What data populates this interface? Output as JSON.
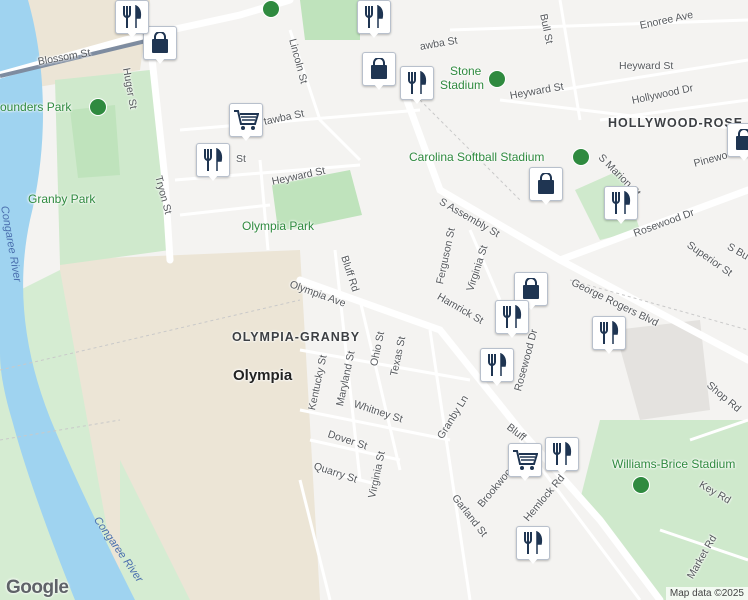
{
  "map": {
    "streets": {
      "blossom": "Blossom St",
      "huger": "Huger St",
      "lincoln": "Lincoln St",
      "catawba1": "awba St",
      "catawba2": "tawba St",
      "heyward_w": "Heyward St",
      "heyward_e": "Heyward St",
      "tryon": "Tryon St",
      "greene_frag": "St",
      "s_assembly": "S Assembly St",
      "bluff_rd": "Bluff Rd",
      "bluff_frag": "Bluff",
      "olympia_ave": "Olympia Ave",
      "ferguson": "Ferguson St",
      "virginia_n": "Virginia St",
      "virginia_s": "Virginia St",
      "hamrick": "Hamrick St",
      "rosewood_dr": "Rosewood Dr",
      "rosewood_dr_e": "Rosewood Dr",
      "george_rogers": "George Rogers Blvd",
      "kentucky": "Kentucky St",
      "maryland": "Maryland St",
      "ohio": "Ohio St",
      "texas": "Texas St",
      "whitney": "Whitney St",
      "granby_ln": "Granby Ln",
      "dover": "Dover St",
      "quarry": "Quarry St",
      "brookwood": "Brookwood",
      "garland": "Garland St",
      "hemlock": "Hemlock Rd",
      "key_rd": "Key Rd",
      "market_rd": "Market Rd",
      "shop_rd": "Shop Rd",
      "bull": "Bull St",
      "enoree": "Enoree Ave",
      "hollywood": "Hollywood Dr",
      "s_marion": "S Marion St",
      "superior": "Superior St",
      "pinewood": "Pinewo",
      "s_bu": "S Bu"
    },
    "places": {
      "founders_park": "ounders Park",
      "granby_park": "Granby Park",
      "olympia_park": "Olympia Park",
      "olympia_granby": "OLYMPIA-GRANBY",
      "olympia": "Olympia",
      "stone_stadium": "Stone",
      "stone_stadium2": "Stadium",
      "softball_stadium": "Carolina Softball Stadium",
      "williams_brice": "Williams-Brice Stadium",
      "hollywood_rose": "HOLLYWOOD-ROSE",
      "congaree_river_1": "Congaree River",
      "congaree_river_2": "Congaree River"
    },
    "markers": [
      {
        "type": "shopping-bag"
      },
      {
        "type": "shopping-bag"
      },
      {
        "type": "shopping-bag"
      },
      {
        "type": "shopping-bag"
      },
      {
        "type": "shopping-bag"
      },
      {
        "type": "shopping-cart"
      },
      {
        "type": "shopping-cart"
      },
      {
        "type": "restaurant"
      },
      {
        "type": "restaurant"
      },
      {
        "type": "restaurant"
      },
      {
        "type": "restaurant"
      },
      {
        "type": "restaurant"
      },
      {
        "type": "restaurant"
      },
      {
        "type": "restaurant"
      },
      {
        "type": "restaurant"
      },
      {
        "type": "restaurant"
      },
      {
        "type": "restaurant"
      }
    ],
    "attribution": {
      "logo": "Google",
      "data": "Map data ©2025"
    },
    "colors": {
      "land": "#f4f3f1",
      "river": "#9fd3f0",
      "park": "#c6e7c4",
      "sand": "#ede6d8",
      "road": "#ffffff",
      "marker_icon": "#1f3552"
    }
  }
}
